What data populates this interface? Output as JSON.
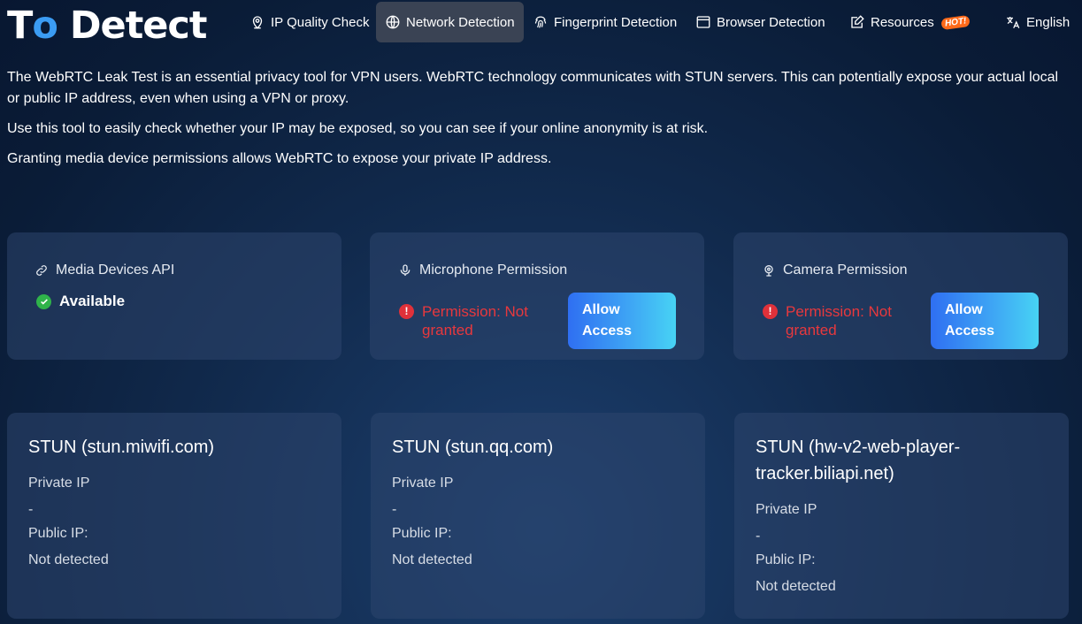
{
  "header": {
    "logo": {
      "part1": "T",
      "part2": "o",
      "part3": " Detect"
    },
    "nav": [
      {
        "label": "IP Quality Check",
        "icon": "location-pin-icon"
      },
      {
        "label": "Network Detection",
        "icon": "globe-icon",
        "active": true
      },
      {
        "label": "Fingerprint Detection",
        "icon": "fingerprint-icon"
      },
      {
        "label": "Browser Detection",
        "icon": "browser-window-icon"
      },
      {
        "label": "Resources",
        "icon": "edit-note-icon",
        "badge": "HOT!"
      }
    ],
    "language": {
      "label": "English",
      "icon": "translate-icon"
    }
  },
  "intro": {
    "p1": "The WebRTC Leak Test is an essential privacy tool for VPN users. WebRTC technology communicates with STUN servers. This can potentially expose your actual local or public IP address, even when using a VPN or proxy.",
    "p2": "Use this tool to easily check whether your IP may be exposed, so you can see if your online anonymity is at risk.",
    "p3": "Granting media device permissions allows WebRTC to expose your private IP address."
  },
  "permissions": {
    "media": {
      "title": "Media Devices API",
      "status": "Available",
      "icon": "link-icon"
    },
    "microphone": {
      "title": "Microphone Permission",
      "status": "Permission: Not granted",
      "button": "Allow Access",
      "icon": "microphone-icon"
    },
    "camera": {
      "title": "Camera Permission",
      "status": "Permission: Not granted",
      "button": "Allow Access",
      "icon": "camera-icon"
    }
  },
  "stun": [
    {
      "title": "STUN (stun.miwifi.com)",
      "private_label": "Private IP",
      "private_value": "-",
      "public_label": "Public IP:",
      "public_value": "Not detected"
    },
    {
      "title": "STUN (stun.qq.com)",
      "private_label": "Private IP",
      "private_value": "-",
      "public_label": "Public IP:",
      "public_value": "Not detected"
    },
    {
      "title": "STUN (hw-v2-web-player-tracker.biliapi.net)",
      "private_label": "Private IP",
      "private_value": "-",
      "public_label": "Public IP:",
      "public_value": "Not detected"
    }
  ],
  "colors": {
    "accent": "#3b9cf3",
    "error": "#e8383d",
    "success": "#2fb34a",
    "button_gradient_start": "#2f6ff2",
    "button_gradient_end": "#47d3f4"
  }
}
